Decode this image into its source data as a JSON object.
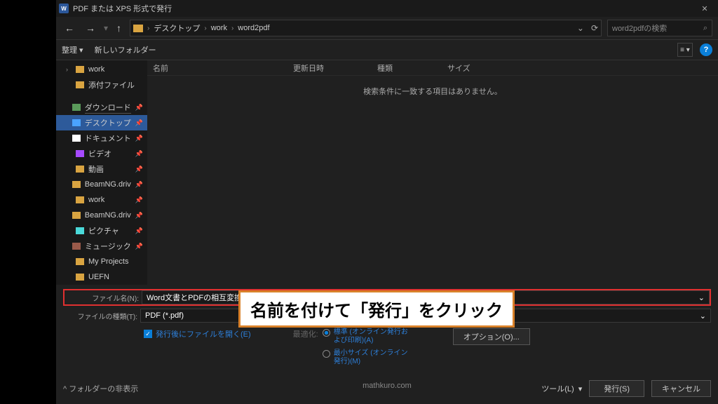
{
  "title": "PDF または XPS 形式で発行",
  "breadcrumb": [
    "デスクトップ",
    "work",
    "word2pdf"
  ],
  "search_placeholder": "word2pdfの検索",
  "toolbar": {
    "organize": "整理 ▾",
    "newfolder": "新しいフォルダー"
  },
  "columns": {
    "name": "名前",
    "date": "更新日時",
    "type": "種類",
    "size": "サイズ"
  },
  "empty": "検索条件に一致する項目はありません。",
  "sidebar": [
    {
      "label": "work",
      "icon": "fico",
      "chev": "›"
    },
    {
      "label": "添付ファイル",
      "icon": "fico",
      "chev": ""
    },
    {
      "sep": true
    },
    {
      "label": "ダウンロード",
      "icon": "fico dl",
      "pin": true,
      "underline": true
    },
    {
      "label": "デスクトップ",
      "icon": "fico blue",
      "pin": true,
      "sel": true
    },
    {
      "label": "ドキュメント",
      "icon": "fico",
      "pin": true,
      "doc": true
    },
    {
      "label": "ビデオ",
      "icon": "fico purple",
      "pin": true
    },
    {
      "label": "動画",
      "icon": "fico",
      "pin": true
    },
    {
      "label": "BeamNG.driv",
      "icon": "fico",
      "pin": true
    },
    {
      "label": "work",
      "icon": "fico",
      "pin": true
    },
    {
      "label": "BeamNG.driv",
      "icon": "fico",
      "pin": true
    },
    {
      "label": "ピクチャ",
      "icon": "fico cyan",
      "pin": true
    },
    {
      "label": "ミュージック",
      "icon": "fico green",
      "pin": true
    },
    {
      "label": "My Projects",
      "icon": "fico"
    },
    {
      "label": "UEFN",
      "icon": "fico"
    }
  ],
  "annotation": "名前を付けて「発行」をクリック",
  "filename_label": "ファイル名(N):",
  "filename_value": "Word文書とPDFの相互変換について.pdf",
  "filetype_label": "ファイルの種類(T):",
  "filetype_value": "PDF (*.pdf)",
  "open_after": "発行後にファイルを開く(E)",
  "optimize_label": "最適化:",
  "opt_standard": "標準 (オンライン発行および印刷)(A)",
  "opt_min": "最小サイズ (オンライン発行)(M)",
  "options_btn": "オプション(O)...",
  "hide_folders": "^ フォルダーの非表示",
  "tools": "ツール(L)",
  "publish": "発行(S)",
  "cancel": "キャンセル",
  "watermark": "mathkuro.com"
}
